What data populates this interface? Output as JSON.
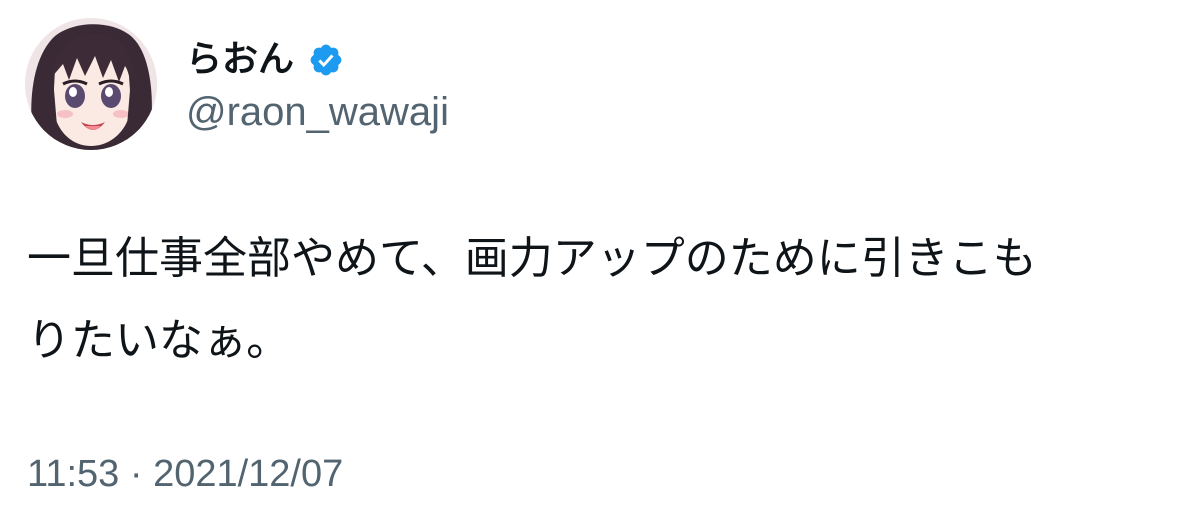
{
  "user": {
    "display_name": "らおん",
    "handle": "@raon_wawaji",
    "verified_icon": "verified-badge-icon",
    "avatar_icon": "anime-girl-avatar"
  },
  "tweet": {
    "text_lines": [
      "一旦仕事全部やめて、画力アップのために引きこも",
      "りたいなぁ。"
    ],
    "time": "11:53",
    "separator": "·",
    "date": "2021/12/07"
  },
  "colors": {
    "text_primary": "#0f1419",
    "text_secondary": "#536471",
    "verified_blue": "#1d9bf0",
    "background": "#ffffff"
  }
}
